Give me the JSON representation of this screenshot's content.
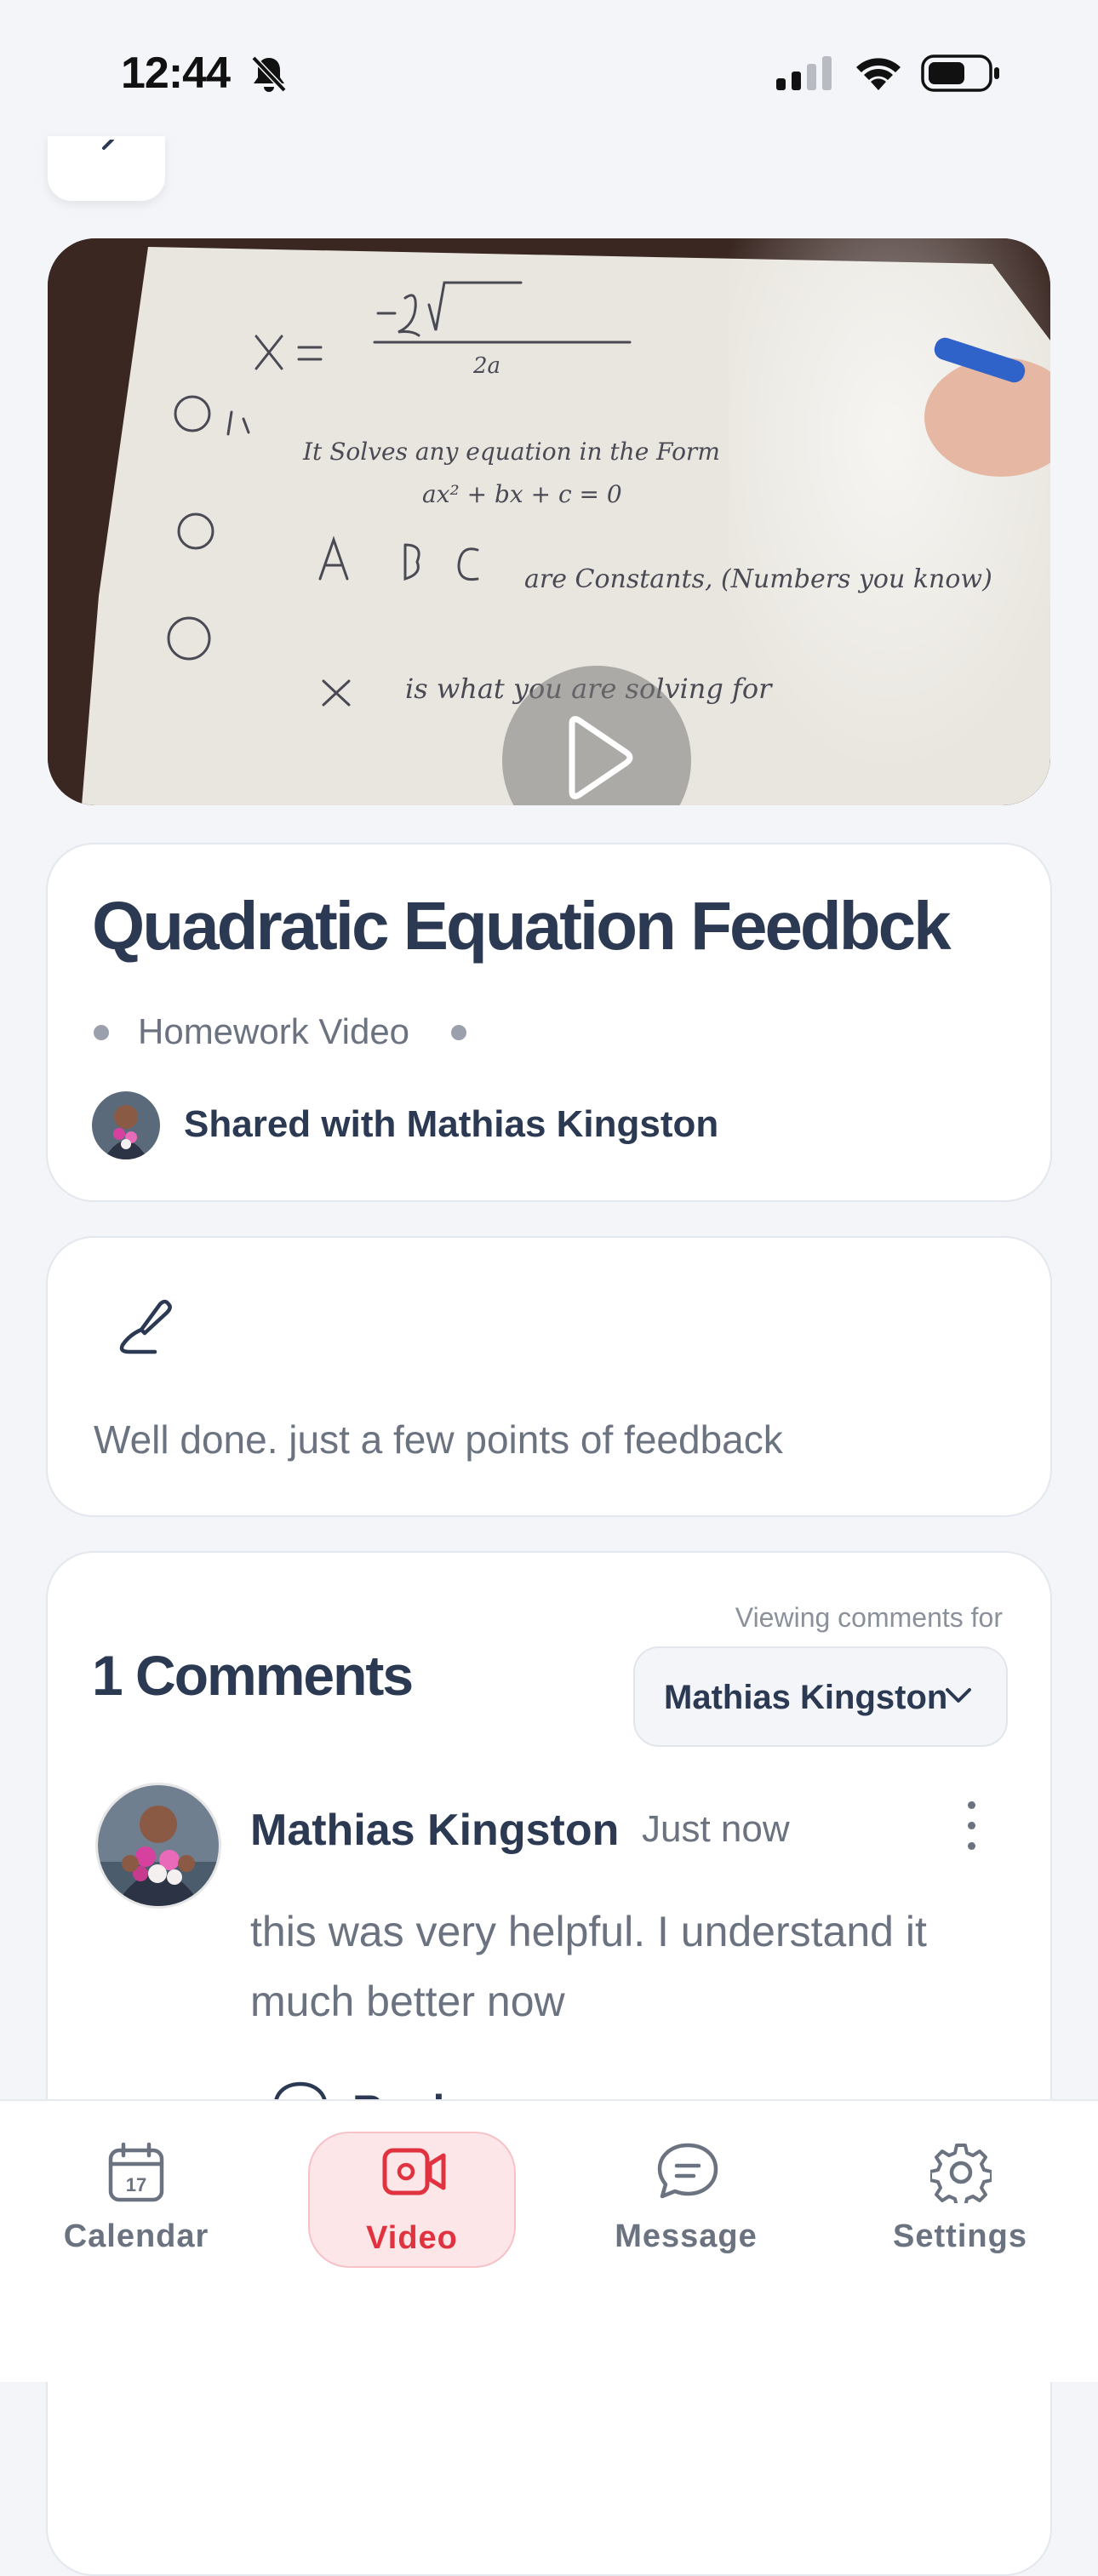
{
  "status_bar": {
    "time": "12:44",
    "icons": [
      "bell-slash-icon",
      "cellular-signal-icon",
      "wifi-icon",
      "battery-icon"
    ]
  },
  "back_button": {
    "icon": "chevron-left-icon"
  },
  "video": {
    "thumbnail": {
      "formula_lines": [
        "X = -b ± √(b² - 4ac) / 2a"
      ],
      "handwritten_notes": [
        "① It solves any equation in the Form ax² + bx + c = 0",
        "② A, B, C are Constants, (Numbers you know)",
        "③ X is what you are solving for"
      ]
    },
    "play_icon": "play-icon"
  },
  "title_card": {
    "title": "Quadratic Equation Feedbck",
    "category": "Homework Video",
    "shared_with": "Shared with Mathias Kingston"
  },
  "note_card": {
    "icon": "pen-icon",
    "text": "Well done. just a few points of feedback"
  },
  "comments": {
    "title": "1 Comments",
    "viewing_label": "Viewing comments for",
    "viewing_selected": "Mathias Kingston",
    "items": [
      {
        "author": "Mathias Kingston",
        "time": "Just now",
        "text": "this was very helpful. I understand it much better now",
        "reply_label": "Reply"
      }
    ]
  },
  "tabbar": {
    "tabs": [
      {
        "label": "Calendar",
        "icon": "calendar-icon"
      },
      {
        "label": "Video",
        "icon": "video-icon",
        "active": true
      },
      {
        "label": "Message",
        "icon": "message-icon"
      },
      {
        "label": "Settings",
        "icon": "gear-icon"
      }
    ]
  },
  "colors": {
    "accent": "#e0333f",
    "accent_bg": "#fde6e8",
    "text_dark": "#2b3a52",
    "text_muted": "#6b7280"
  }
}
